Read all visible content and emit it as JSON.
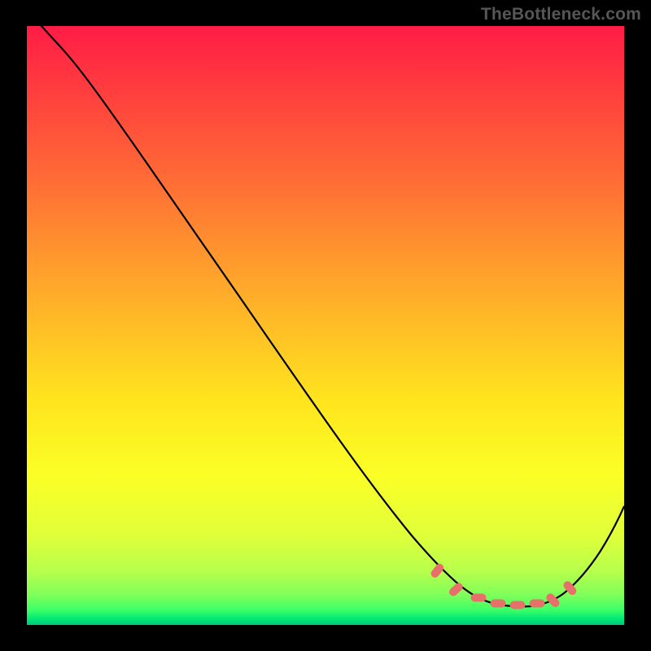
{
  "watermark": "TheBottleneck.com",
  "chart_data": {
    "type": "line",
    "title": "",
    "xlabel": "",
    "ylabel": "",
    "xlim": [
      0,
      100
    ],
    "ylim": [
      0,
      100
    ],
    "background_gradient": {
      "top_color": "#ff1c46",
      "bottom_color": "#00c77e",
      "note": "vertical rainbow gradient from red (high bottleneck) through orange, yellow, to green (low bottleneck)"
    },
    "series": [
      {
        "name": "bottleneck-curve",
        "color": "#000000",
        "stroke_width": 2,
        "x": [
          0,
          4,
          10,
          16,
          22,
          28,
          34,
          40,
          46,
          52,
          58,
          63,
          68,
          72,
          76,
          80,
          84,
          88,
          92,
          96,
          100
        ],
        "values": [
          103,
          100,
          94,
          86,
          78,
          69,
          60,
          51,
          42,
          34,
          26,
          19,
          13,
          9,
          6,
          5,
          5,
          6,
          9,
          15,
          23
        ]
      },
      {
        "name": "optimal-range-markers",
        "type": "scatter",
        "color": "#e86a62",
        "marker_shape": "rounded-capsule",
        "x": [
          69,
          73,
          76,
          79,
          82,
          85,
          88,
          91
        ],
        "values": [
          9.8,
          7.4,
          6.0,
          5.3,
          5.0,
          5.2,
          6.0,
          7.6
        ]
      }
    ],
    "note": "Axes are unlabeled in the image; values are estimated from pixel positions. y=0 at bottom (green), y≈100 at top (red)."
  }
}
